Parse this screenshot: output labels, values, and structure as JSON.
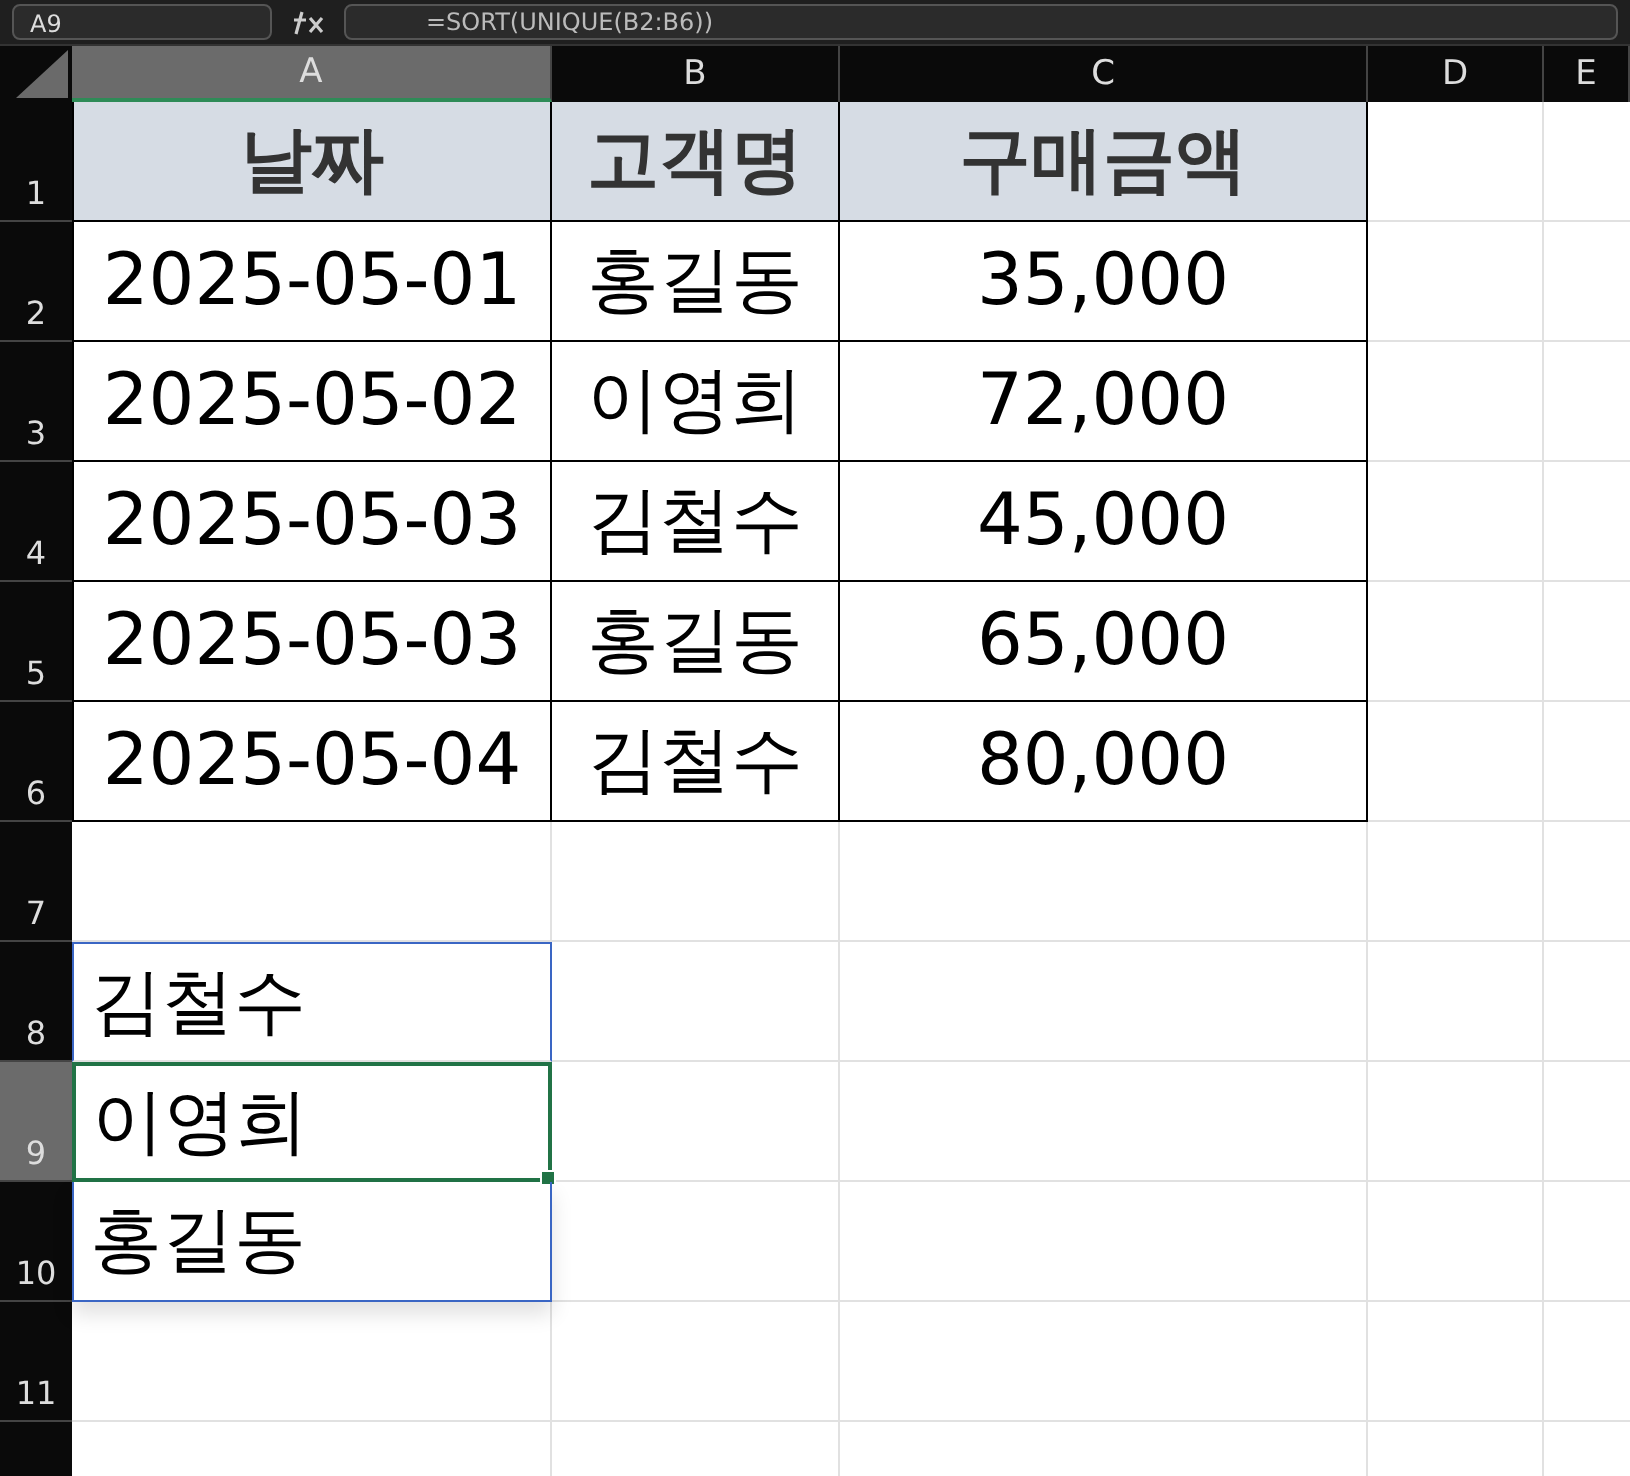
{
  "name_box": "A9",
  "formula": "=SORT(UNIQUE(B2:B6))",
  "columns": [
    {
      "label": "A",
      "selected": true
    },
    {
      "label": "B",
      "selected": false
    },
    {
      "label": "C",
      "selected": false
    },
    {
      "label": "D",
      "selected": false
    },
    {
      "label": "E",
      "selected": false
    }
  ],
  "rows": [
    {
      "label": "1",
      "selected": false,
      "cells": [
        {
          "text": "날짜",
          "kind": "header",
          "selected": false
        },
        {
          "text": "고객명",
          "kind": "header",
          "selected": false
        },
        {
          "text": "구매금액",
          "kind": "header",
          "selected": false
        }
      ]
    },
    {
      "label": "2",
      "selected": false,
      "cells": [
        {
          "text": "2025-05-01",
          "kind": "data",
          "selected": false
        },
        {
          "text": "홍길동",
          "kind": "data",
          "selected": false
        },
        {
          "text": "35,000",
          "kind": "data",
          "selected": false
        }
      ]
    },
    {
      "label": "3",
      "selected": false,
      "cells": [
        {
          "text": "2025-05-02",
          "kind": "data",
          "selected": false
        },
        {
          "text": "이영희",
          "kind": "data",
          "selected": false
        },
        {
          "text": "72,000",
          "kind": "data",
          "selected": false
        }
      ]
    },
    {
      "label": "4",
      "selected": false,
      "cells": [
        {
          "text": "2025-05-03",
          "kind": "data",
          "selected": false
        },
        {
          "text": "김철수",
          "kind": "data",
          "selected": false
        },
        {
          "text": "45,000",
          "kind": "data",
          "selected": false
        }
      ]
    },
    {
      "label": "5",
      "selected": false,
      "cells": [
        {
          "text": "2025-05-03",
          "kind": "data",
          "selected": false
        },
        {
          "text": "홍길동",
          "kind": "data",
          "selected": false
        },
        {
          "text": "65,000",
          "kind": "data",
          "selected": false
        }
      ]
    },
    {
      "label": "6",
      "selected": false,
      "cells": [
        {
          "text": "2025-05-04",
          "kind": "data",
          "selected": false
        },
        {
          "text": "김철수",
          "kind": "data",
          "selected": false
        },
        {
          "text": "80,000",
          "kind": "data",
          "selected": false
        }
      ]
    },
    {
      "label": "7",
      "selected": false,
      "cells": []
    },
    {
      "label": "8",
      "selected": false,
      "cells": [
        {
          "text": "김철수",
          "kind": "spill",
          "selected": false
        }
      ]
    },
    {
      "label": "9",
      "selected": true,
      "cells": [
        {
          "text": "이영희",
          "kind": "spill",
          "selected": true
        }
      ]
    },
    {
      "label": "10",
      "selected": false,
      "cells": [
        {
          "text": "홍길동",
          "kind": "spill",
          "selected": false
        }
      ]
    },
    {
      "label": "11",
      "selected": false,
      "cells": []
    }
  ]
}
